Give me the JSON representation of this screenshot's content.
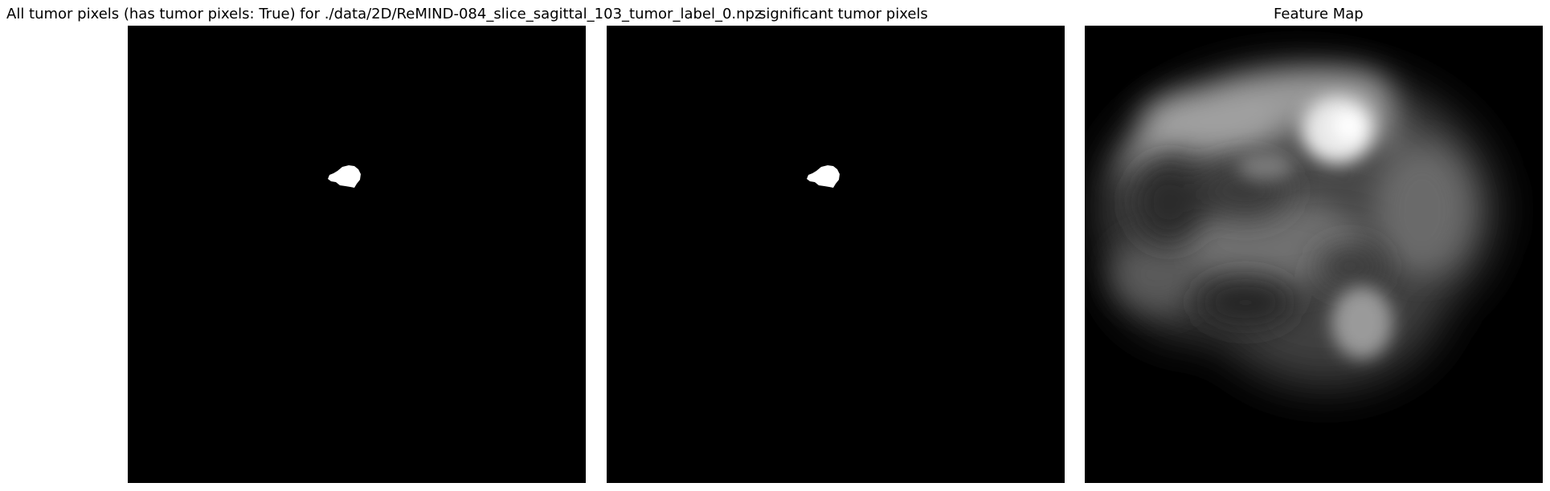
{
  "panels": [
    {
      "title": "All tumor pixels (has tumor pixels: True) for ./data/2D/ReMIND-084_slice_sagittal_103_tumor_label_0.npz",
      "content": "binary tumor mask"
    },
    {
      "title": "significant tumor pixels",
      "content": "binary tumor mask"
    },
    {
      "title": "Feature Map",
      "content": "grayscale blurred feature map"
    }
  ],
  "colors": {
    "background": "#ffffff",
    "panel_background": "#000000",
    "mask": "#ffffff"
  }
}
